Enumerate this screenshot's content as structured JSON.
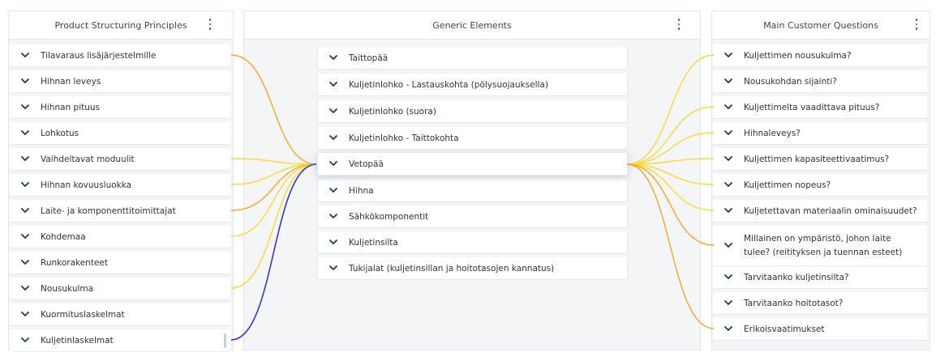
{
  "colors": {
    "yellow": "#fbd835",
    "orange": "#f5a623",
    "blue": "#3a2fdc",
    "chevron": "#1b3a5a"
  },
  "icons": {
    "expand": "chevron-down-icon",
    "menu": "kebab-menu-icon"
  },
  "left_panel": {
    "title": "Product Structuring Principles",
    "items": [
      "Tilavaraus lisäjärjestelmille",
      "Hihnan leveys",
      "Hihnan pituus",
      "Lohkotus",
      "Vaihdeltavat moduulit",
      "Hihnan kovuusluokka",
      "Laite- ja komponenttitoimittajat",
      "Kohdemaa",
      "Runkorakenteet",
      "Nousukulma",
      "Kuormituslaskelmat",
      "Kuljetinlaskelmat"
    ]
  },
  "mid_panel": {
    "title": "Generic Elements",
    "items": [
      "Taittopää",
      "Kuljetinlohko - Lastauskohta (pölysuojauksella)",
      "Kuljetinlohko (suora)",
      "Kuljetinlohko - Taittokohta",
      "Vetopää",
      "Hihna",
      "Sähkökomponentit",
      "Kuljetinsilta",
      "Tukijalat (kuljetinsillan ja hoitotasojen kannatus)"
    ],
    "active_index": 4
  },
  "right_panel": {
    "title": "Main Customer Questions",
    "items": [
      "Kuljettimen nousukulma?",
      "Nousukohdan sijainti?",
      "Kuljettimelta vaadittava pituus?",
      "Hihnaleveys?",
      "Kuljettimen kapasiteettivaatimus?",
      "Kuljettimen nopeus?",
      "Kuljetettavan materiaalin ominaisuudet?",
      "Millainen on ympäristö, johon laite tulee? (reitityksen ja tuennan esteet)",
      "Tarvitaanko kuljetinsilta?",
      "Tarvitaanko hoitotasot?",
      "Erikoisvaatimukset"
    ]
  },
  "left_connections": [
    {
      "item": 0,
      "color": "orange"
    },
    {
      "item": 4,
      "color": "yellow"
    },
    {
      "item": 5,
      "color": "yellow"
    },
    {
      "item": 6,
      "color": "orange"
    },
    {
      "item": 7,
      "color": "yellow"
    },
    {
      "item": 9,
      "color": "yellow"
    },
    {
      "item": 11,
      "color": "blue"
    }
  ],
  "right_connections": [
    {
      "item": 0,
      "color": "yellow"
    },
    {
      "item": 2,
      "color": "yellow"
    },
    {
      "item": 3,
      "color": "yellow"
    },
    {
      "item": 4,
      "color": "yellow"
    },
    {
      "item": 5,
      "color": "yellow"
    },
    {
      "item": 6,
      "color": "yellow"
    },
    {
      "item": 7,
      "color": "orange"
    },
    {
      "item": 10,
      "color": "orange"
    }
  ]
}
